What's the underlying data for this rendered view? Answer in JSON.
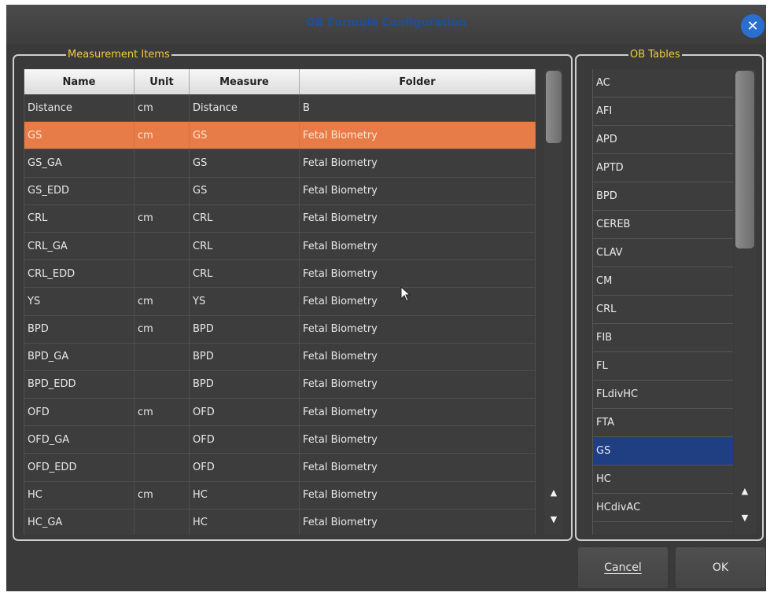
{
  "window": {
    "title": "OB Formula Configuration"
  },
  "measurement_items": {
    "legend": "Measurement Items",
    "columns": [
      "Name",
      "Unit",
      "Measure",
      "Folder"
    ],
    "rows": [
      {
        "name": "Distance",
        "unit": "cm",
        "measure": "Distance",
        "folder": "B"
      },
      {
        "name": "GS",
        "unit": "cm",
        "measure": "GS",
        "folder": "Fetal Biometry"
      },
      {
        "name": "GS_GA",
        "unit": "",
        "measure": "GS",
        "folder": "Fetal Biometry"
      },
      {
        "name": "GS_EDD",
        "unit": "",
        "measure": "GS",
        "folder": "Fetal Biometry"
      },
      {
        "name": "CRL",
        "unit": "cm",
        "measure": "CRL",
        "folder": "Fetal Biometry"
      },
      {
        "name": "CRL_GA",
        "unit": "",
        "measure": "CRL",
        "folder": "Fetal Biometry"
      },
      {
        "name": "CRL_EDD",
        "unit": "",
        "measure": "CRL",
        "folder": "Fetal Biometry"
      },
      {
        "name": "YS",
        "unit": "cm",
        "measure": "YS",
        "folder": "Fetal Biometry"
      },
      {
        "name": "BPD",
        "unit": "cm",
        "measure": "BPD",
        "folder": "Fetal Biometry"
      },
      {
        "name": "BPD_GA",
        "unit": "",
        "measure": "BPD",
        "folder": "Fetal Biometry"
      },
      {
        "name": "BPD_EDD",
        "unit": "",
        "measure": "BPD",
        "folder": "Fetal Biometry"
      },
      {
        "name": "OFD",
        "unit": "cm",
        "measure": "OFD",
        "folder": "Fetal Biometry"
      },
      {
        "name": "OFD_GA",
        "unit": "",
        "measure": "OFD",
        "folder": "Fetal Biometry"
      },
      {
        "name": "OFD_EDD",
        "unit": "",
        "measure": "OFD",
        "folder": "Fetal Biometry"
      },
      {
        "name": "HC",
        "unit": "cm",
        "measure": "HC",
        "folder": "Fetal Biometry"
      },
      {
        "name": "HC_GA",
        "unit": "",
        "measure": "HC",
        "folder": "Fetal Biometry"
      }
    ]
  },
  "ob_tables": {
    "legend": "OB Tables",
    "items": [
      "AC",
      "AFI",
      "APD",
      "APTD",
      "BPD",
      "CEREB",
      "CLAV",
      "CM",
      "CRL",
      "FIB",
      "FL",
      "FLdivHC",
      "FTA",
      "GS",
      "HC",
      "HCdivAC"
    ]
  },
  "buttons": {
    "cancel": "Cancel",
    "ok": "OK"
  },
  "colors": {
    "row_selected": "#e87c48",
    "list_selected": "#1f3f82",
    "legend": "#f0cd3a",
    "title": "#1f4f97"
  }
}
